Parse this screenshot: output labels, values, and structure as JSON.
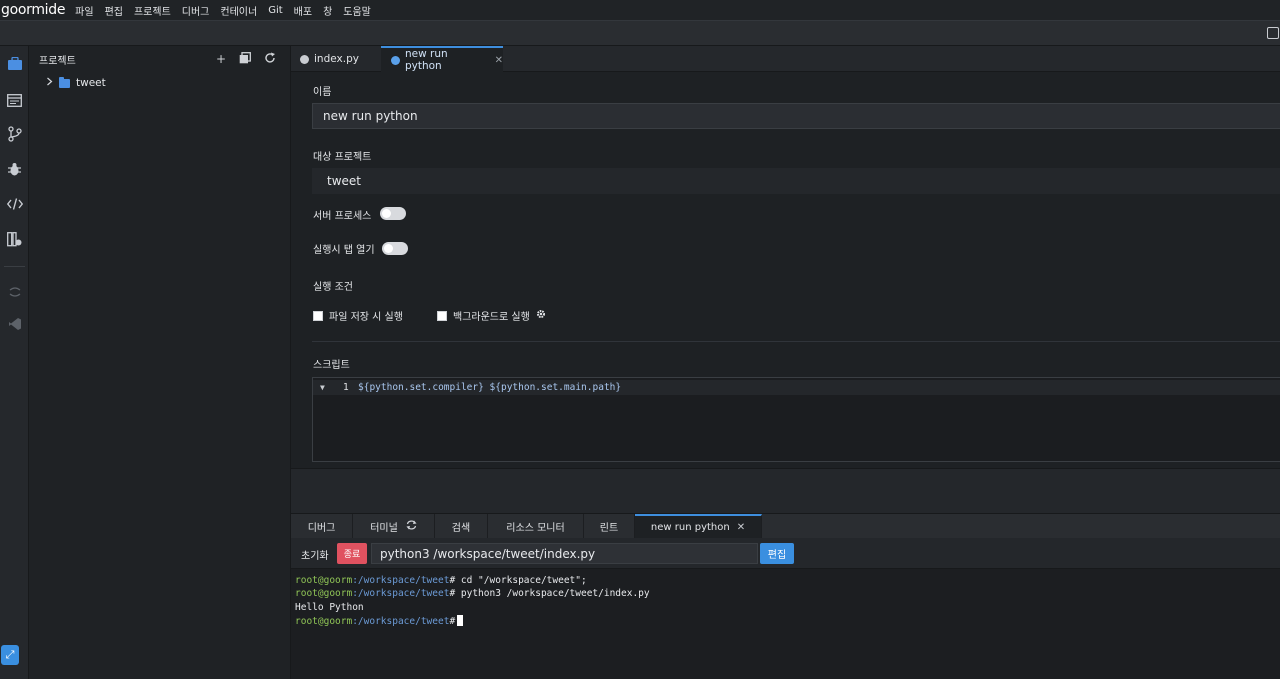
{
  "app": {
    "logo": "goormide",
    "menu": [
      "파일",
      "편집",
      "프로젝트",
      "디버그",
      "컨테이너",
      "Git",
      "배포",
      "창",
      "도움말"
    ]
  },
  "activity_icons": [
    "briefcase-icon",
    "panel-icon",
    "git-branch-icon",
    "bug-icon",
    "code-icon",
    "extensions-icon",
    "sync-icon",
    "vscode-icon",
    "expand-icon"
  ],
  "project_panel": {
    "title": "프로젝트",
    "tree": [
      {
        "label": "tweet",
        "type": "folder",
        "expanded": false
      }
    ]
  },
  "editor_tabs": [
    {
      "label": "index.py",
      "active": false
    },
    {
      "label": "new run python",
      "active": true
    }
  ],
  "run_config": {
    "name_label": "이름",
    "name_value": "new run python",
    "project_label": "대상 프로젝트",
    "project_value": "tweet",
    "server_process_label": "서버 프로세스",
    "server_process_on": false,
    "open_tab_label": "실행시 탭 열기",
    "open_tab_on": false,
    "conditions_label": "실행 조건",
    "cond_save_label": "파일 저장 시 실행",
    "cond_save_checked": false,
    "cond_bg_label": "백그라운드로 실행",
    "cond_bg_checked": false,
    "script_label": "스크립트",
    "script_line_number": "1",
    "script_code": "${python.set.compiler} ${python.set.main.path}"
  },
  "bottom_tabs": [
    {
      "label": "디버그"
    },
    {
      "label": "터미널"
    },
    {
      "label": "검색"
    },
    {
      "label": "리소스 모니터"
    },
    {
      "label": "린트"
    },
    {
      "label": "new run python",
      "active": true
    }
  ],
  "run_bar": {
    "reset_label": "초기화",
    "stop_label": "종료",
    "command": "python3 /workspace/tweet/index.py",
    "edit_label": "편집"
  },
  "terminal": {
    "user": "root@goorm",
    "lines": [
      {
        "path": ":/workspace/tweet",
        "cmd": "# cd \"/workspace/tweet\";"
      },
      {
        "path": ":/workspace/tweet",
        "cmd": "# python3 /workspace/tweet/index.py"
      },
      {
        "output": "Hello Python"
      },
      {
        "path": ":/workspace/tweet",
        "cmd": "#"
      }
    ]
  },
  "colors": {
    "accent": "#3a8fe0",
    "stop": "#e05260",
    "terminal_user": "#8fc456",
    "terminal_path": "#6c9bd6"
  }
}
